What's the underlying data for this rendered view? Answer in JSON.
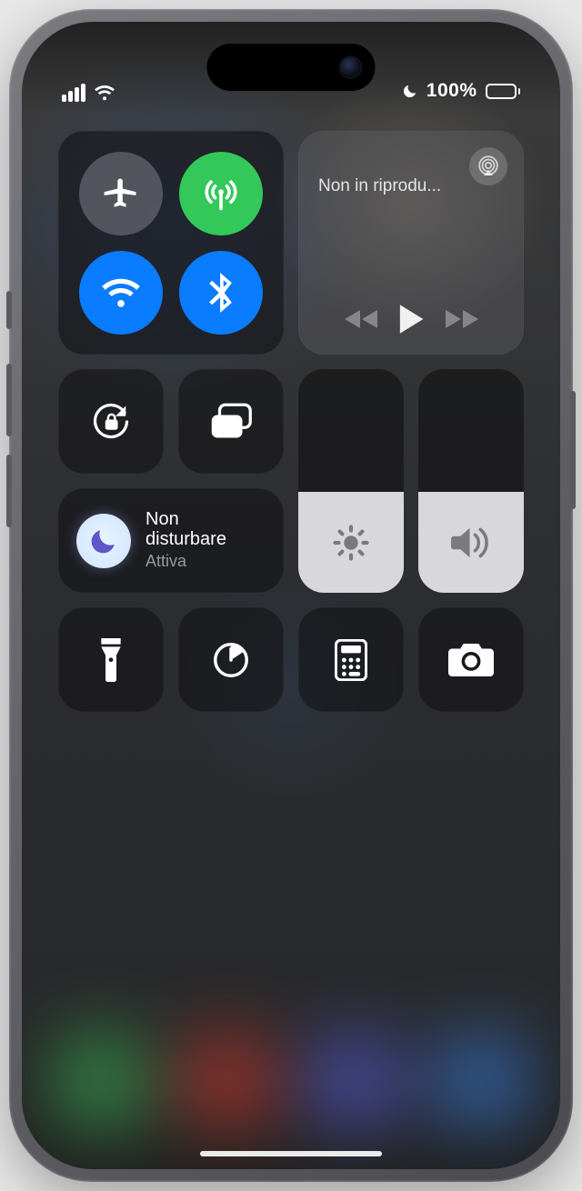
{
  "status": {
    "battery_pct": "100%"
  },
  "nowplaying": {
    "title": "Non in riprodu..."
  },
  "focus": {
    "title_line1": "Non",
    "title_line2": "disturbare",
    "state": "Attiva"
  },
  "sliders": {
    "brightness_pct": 45,
    "volume_pct": 45
  }
}
